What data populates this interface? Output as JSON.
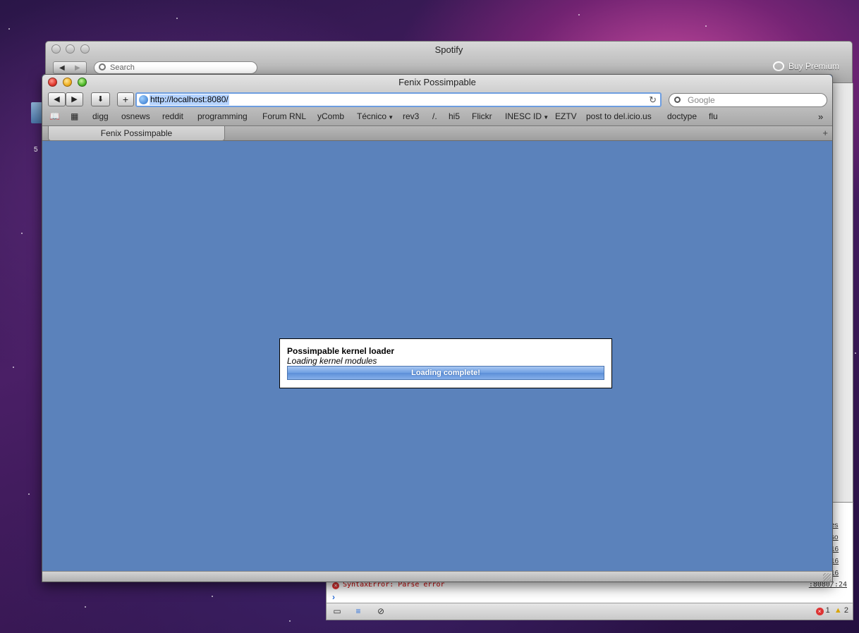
{
  "spotify": {
    "title": "Spotify",
    "search_placeholder": "Search",
    "buy_premium": "Buy Premium"
  },
  "inspector": {
    "error_message": "SyntaxError: Parse error",
    "error_location": ":8080/:24",
    "prompt": "›",
    "error_count": "1",
    "warning_count": "2",
    "side_links": [
      "es",
      "so",
      "16",
      "16",
      "16"
    ]
  },
  "safari": {
    "window_title": "Fenix Possimpable",
    "url": "http://localhost:8080/",
    "search_placeholder": "Google",
    "bookmarks": [
      "digg",
      "osnews",
      "reddit",
      "programming",
      "Forum RNL",
      "yComb",
      "Técnico",
      "rev3",
      "/.",
      "hi5",
      "Flickr",
      "INESC ID",
      "EZTV",
      "post to del.icio.us",
      "doctype",
      "flu"
    ],
    "tab_title": "Fenix Possimpable",
    "page_bg": "#5b82bb"
  },
  "loader": {
    "title": "Possimpable kernel loader",
    "status": "Loading kernel modules",
    "progress_label": "Loading complete!",
    "progress": 1.0
  },
  "desktop": {
    "icon_label": "5"
  },
  "icons": [
    "back-icon",
    "forward-icon",
    "download-icon",
    "add-bookmark-icon",
    "globe-icon",
    "reload-icon",
    "search-icon",
    "reading-list-icon",
    "top-sites-icon",
    "more-bookmarks-icon",
    "new-tab-icon"
  ]
}
